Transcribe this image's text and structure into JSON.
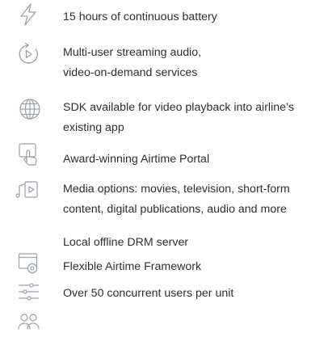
{
  "features": [
    {
      "icon": "lightning-bolt-icon",
      "text": "15 hours of continuous battery"
    },
    {
      "icon": "play-circle-refresh-icon",
      "line1": "Multi-user streaming audio,",
      "line2": "video-on-demand services"
    },
    {
      "icon": "globe-icon",
      "line1": "SDK available for video playback into airline’s",
      "line2": "existing app"
    },
    {
      "icon": "hand-touch-icon",
      "text": "Award-winning Airtime Portal"
    },
    {
      "icon": "media-music-video-icon",
      "line1": "Media options: movies, television, short-form",
      "line2": "content, digital publications, audio and more"
    },
    {
      "text": "Local offline DRM server"
    },
    {
      "icon": "browser-gear-icon",
      "text": "Flexible Airtime Framework"
    },
    {
      "icon": "sliders-icon",
      "text": "Over 50 concurrent users per unit"
    },
    {
      "icon": "users-icon"
    }
  ],
  "colors": {
    "icon_stroke": "#9aa1a8",
    "text": "#2e2e2e"
  }
}
